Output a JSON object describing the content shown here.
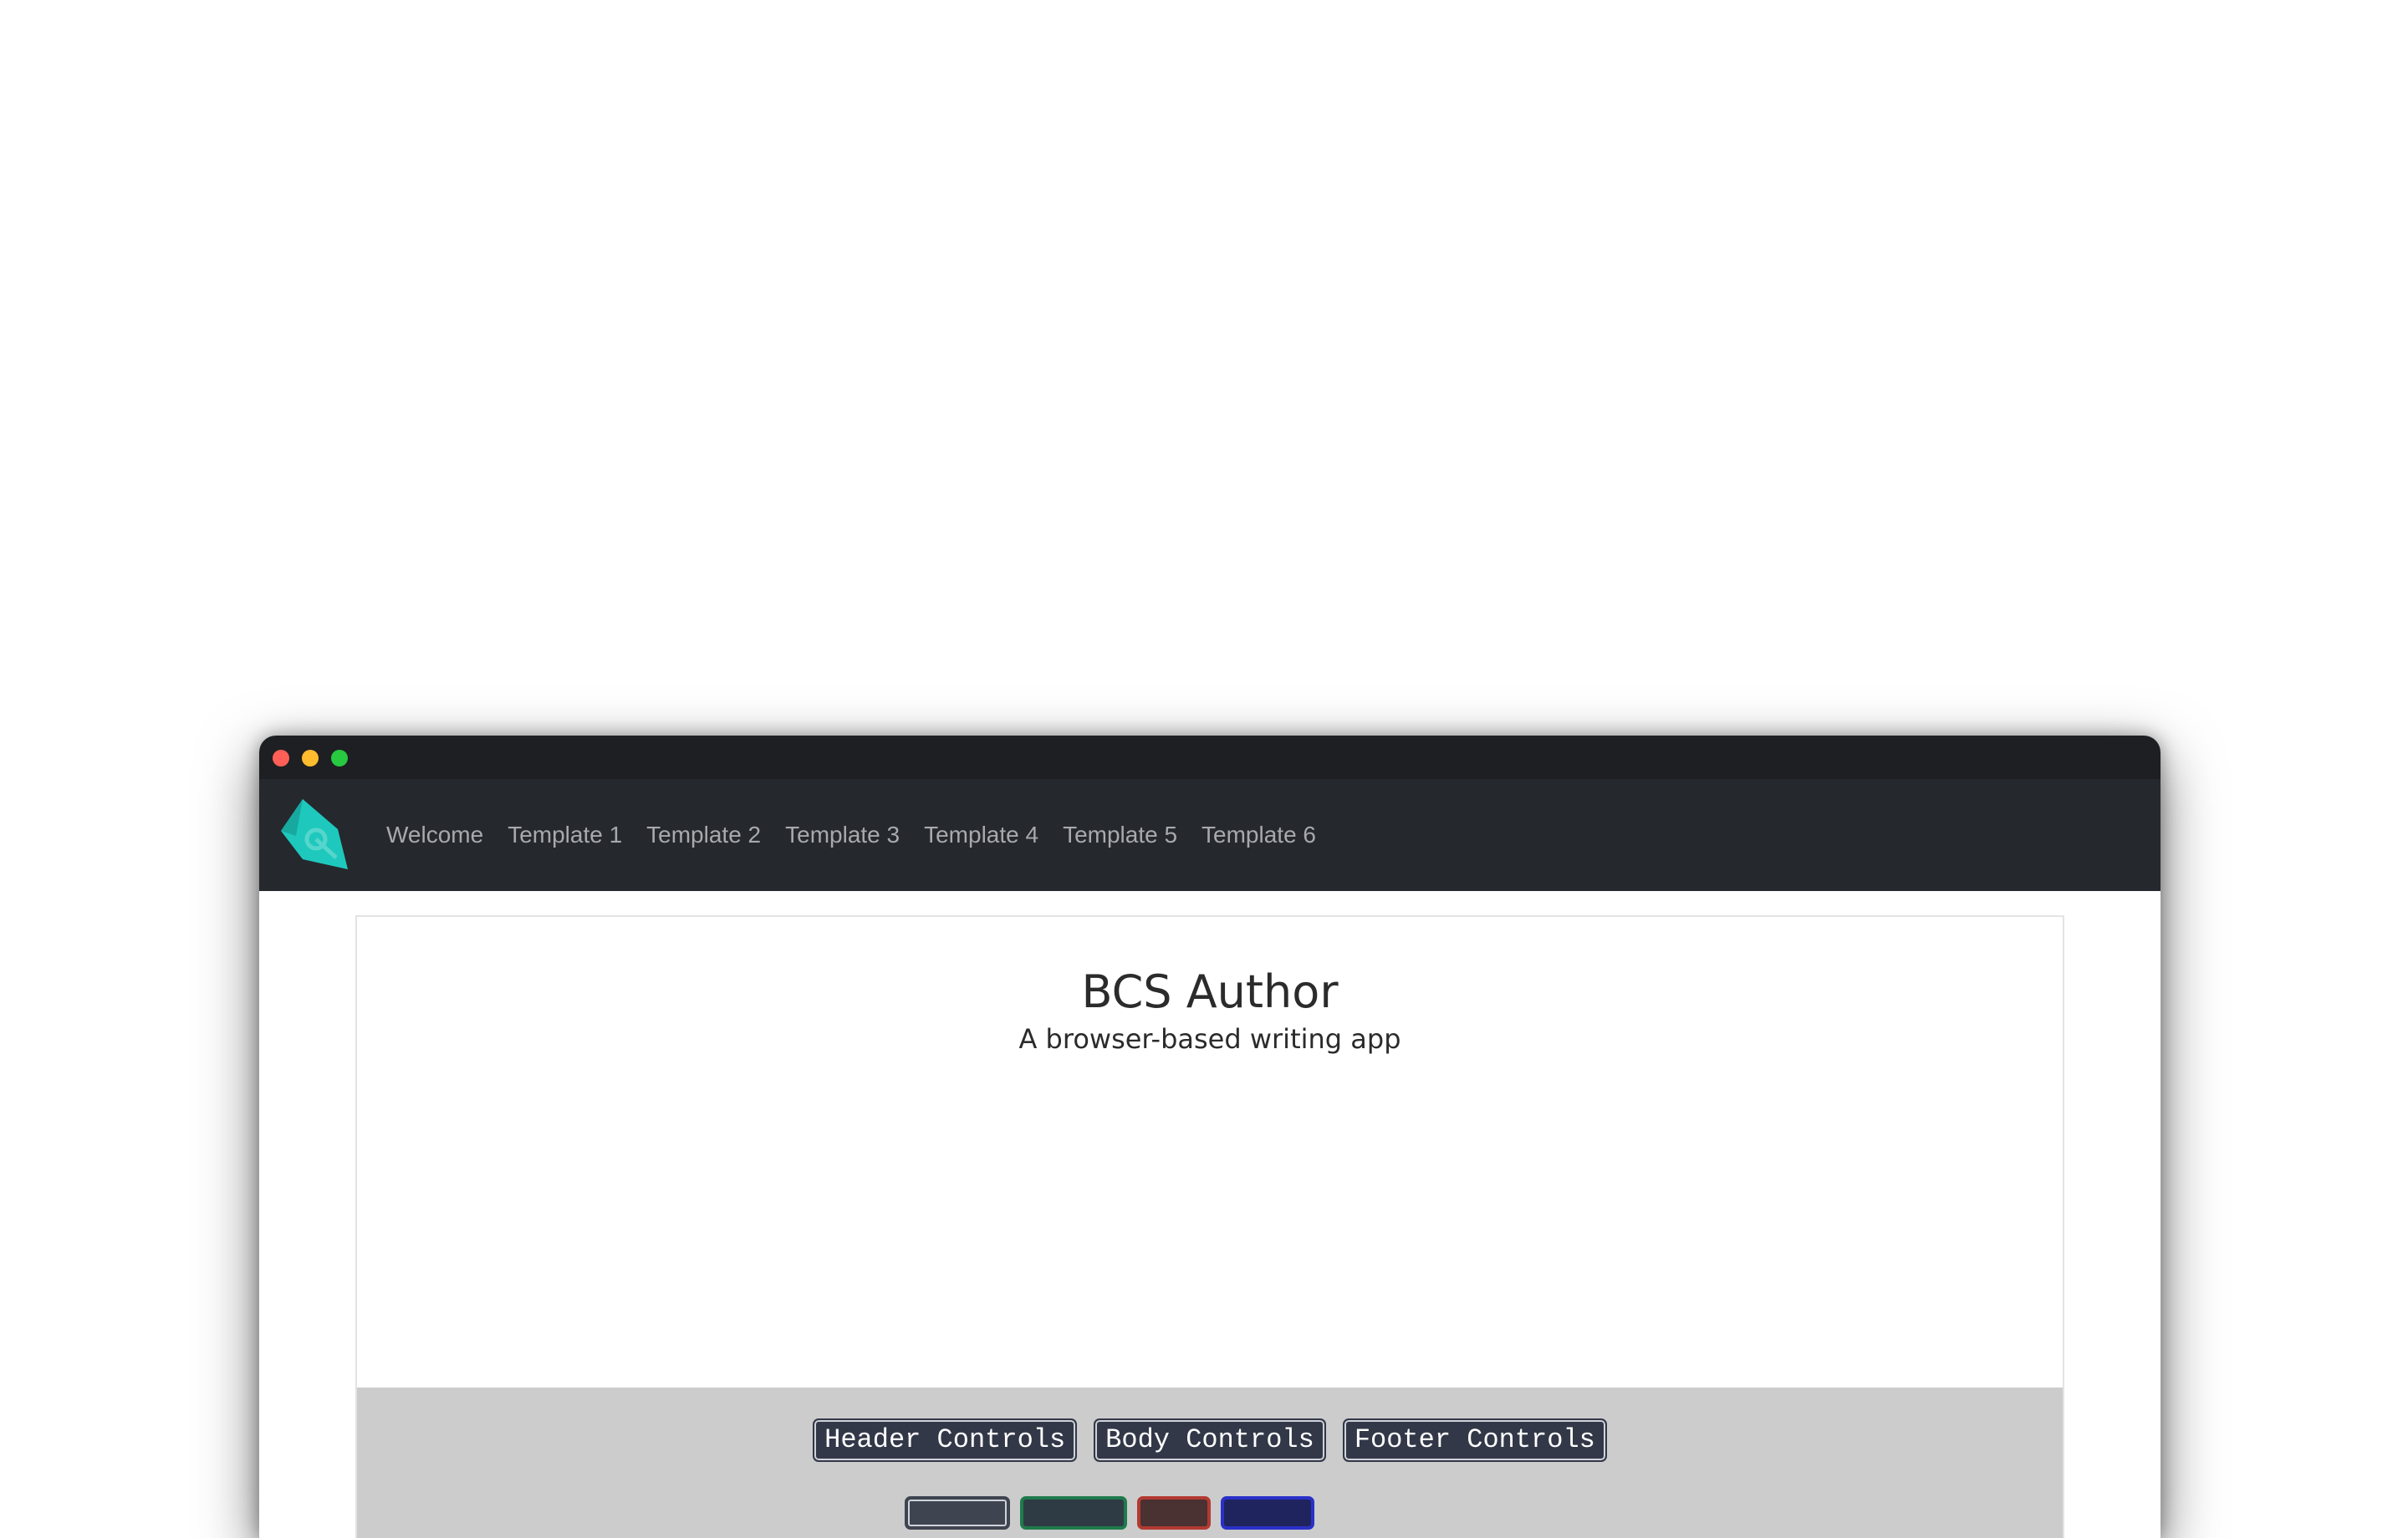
{
  "window": {
    "traffic_lights": {
      "close": "#fe5f57",
      "minimize": "#febc2e",
      "maximize": "#28c840"
    }
  },
  "navbar": {
    "logo_icon": "teal-pen-nib-logo",
    "items": [
      {
        "label": "Welcome"
      },
      {
        "label": "Template 1"
      },
      {
        "label": "Template 2"
      },
      {
        "label": "Template 3"
      },
      {
        "label": "Template 4"
      },
      {
        "label": "Template 5"
      },
      {
        "label": "Template 6"
      }
    ]
  },
  "main": {
    "title": "BCS Author",
    "subtitle": "A browser-based writing app"
  },
  "controls": {
    "buttons": [
      {
        "label": "Header Controls"
      },
      {
        "label": "Body Controls"
      },
      {
        "label": "Footer Controls"
      }
    ]
  },
  "colors": {
    "navbar_bg": "#25282d",
    "accent_teal": "#1ec8bd",
    "controls_bg": "#cccccc",
    "button_bg": "#323848"
  }
}
